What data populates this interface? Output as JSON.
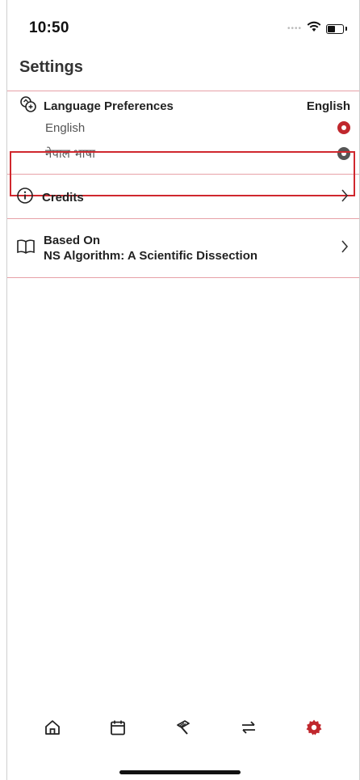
{
  "status_bar": {
    "time": "10:50",
    "signal_icon": "signal-dots-icon",
    "wifi_icon": "wifi-icon",
    "battery_icon": "battery-icon"
  },
  "header": {
    "title": "Settings"
  },
  "language": {
    "icon": "language-icon",
    "label": "Language Preferences",
    "selected_value": "English",
    "options": [
      {
        "name": "English",
        "selected": true
      },
      {
        "name": "नेपाल भाषा",
        "selected": false
      }
    ]
  },
  "credits": {
    "icon": "info-icon",
    "label": "Credits",
    "chevron": "chevron-right-icon"
  },
  "based_on": {
    "icon": "book-icon",
    "label": "Based On",
    "subtitle": "NS Algorithm: A Scientific Dissection",
    "chevron": "chevron-right-icon"
  },
  "tab_bar": {
    "items": [
      {
        "name": "home",
        "icon": "home-icon",
        "active": false
      },
      {
        "name": "calendar",
        "icon": "calendar-icon",
        "active": false
      },
      {
        "name": "tools",
        "icon": "tool-icon",
        "active": false
      },
      {
        "name": "convert",
        "icon": "swap-arrows-icon",
        "active": false
      },
      {
        "name": "settings",
        "icon": "gear-icon",
        "active": true
      }
    ]
  },
  "colors": {
    "accent": "#c0272d",
    "divider": "#e7a1a7",
    "text": "#222222",
    "muted": "#555555"
  }
}
